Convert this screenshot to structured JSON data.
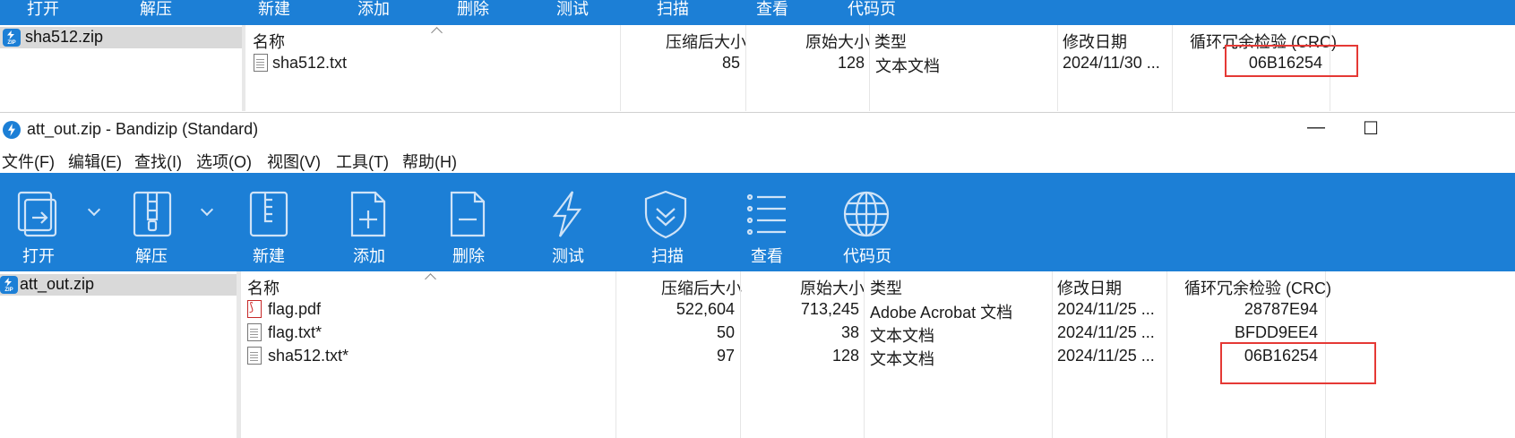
{
  "top_window": {
    "toolbar_labels": [
      "打开",
      "解压",
      "新建",
      "添加",
      "删除",
      "测试",
      "扫描",
      "查看",
      "代码页"
    ],
    "archive": "sha512.zip",
    "columns": [
      "名称",
      "压缩后大小",
      "原始大小",
      "类型",
      "修改日期",
      "循环冗余检验 (CRC)"
    ],
    "rows": [
      {
        "name": "sha512.txt",
        "compressed": "85",
        "original": "128",
        "type": "文本文档",
        "modified": "2024/11/30 ...",
        "crc": "06B16254"
      }
    ]
  },
  "main_window": {
    "title": "att_out.zip - Bandizip (Standard)",
    "window_controls": {
      "minimize": "—",
      "maximize": "☐"
    },
    "menu": [
      "文件(F)",
      "编辑(E)",
      "查找(I)",
      "选项(O)",
      "视图(V)",
      "工具(T)",
      "帮助(H)"
    ],
    "toolbar": [
      {
        "label": "打开",
        "icon": "open-archive-icon"
      },
      {
        "label": "解压",
        "icon": "extract-icon"
      },
      {
        "label": "新建",
        "icon": "new-archive-icon"
      },
      {
        "label": "添加",
        "icon": "add-file-icon"
      },
      {
        "label": "删除",
        "icon": "delete-file-icon"
      },
      {
        "label": "测试",
        "icon": "test-lightning-icon"
      },
      {
        "label": "扫描",
        "icon": "scan-shield-icon"
      },
      {
        "label": "查看",
        "icon": "view-list-icon"
      },
      {
        "label": "代码页",
        "icon": "codepage-globe-icon"
      }
    ],
    "archive": "att_out.zip",
    "columns": [
      "名称",
      "压缩后大小",
      "原始大小",
      "类型",
      "修改日期",
      "循环冗余检验 (CRC)"
    ],
    "rows": [
      {
        "name": "flag.pdf",
        "compressed": "522,604",
        "original": "713,245",
        "type": "Adobe Acrobat 文档",
        "modified": "2024/11/25 ...",
        "crc": "28787E94",
        "icon": "pdf-file-icon"
      },
      {
        "name": "flag.txt*",
        "compressed": "50",
        "original": "38",
        "type": "文本文档",
        "modified": "2024/11/25 ...",
        "crc": "BFDD9EE4",
        "icon": "text-file-icon"
      },
      {
        "name": "sha512.txt*",
        "compressed": "97",
        "original": "128",
        "type": "文本文档",
        "modified": "2024/11/25 ...",
        "crc": "06B16254",
        "icon": "text-file-icon"
      }
    ]
  },
  "colors": {
    "toolbar_blue": "#1c7fd6",
    "highlight_red": "#e53935"
  }
}
